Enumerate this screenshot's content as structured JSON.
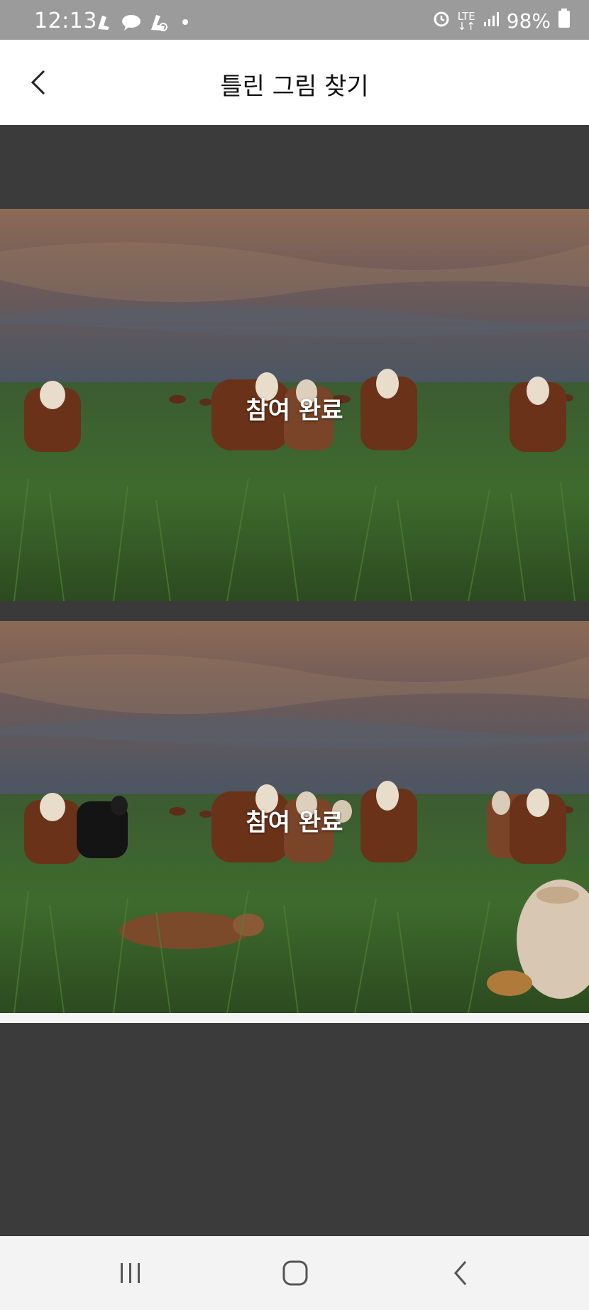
{
  "status_bar": {
    "time": "12:13",
    "battery": "98%",
    "network": "LTE",
    "icons": [
      "notification-icon-1",
      "message-icon",
      "notification-icon-2",
      "dot-icon",
      "alarm-icon",
      "lte-icon",
      "signal-icon",
      "battery-icon"
    ]
  },
  "header": {
    "title": "틀린 그림 찾기",
    "back_icon": "chevron-left-icon"
  },
  "game": {
    "top_image_label": "참여 완료",
    "bottom_image_label": "참여 완료"
  },
  "nav_bar": {
    "icons": [
      "recent-apps-icon",
      "home-icon",
      "back-icon"
    ]
  },
  "colors": {
    "status_bar": "#9b9b9b",
    "header": "#ffffff",
    "background": "#3b3b3b",
    "nav_bar": "#f3f3f3"
  }
}
